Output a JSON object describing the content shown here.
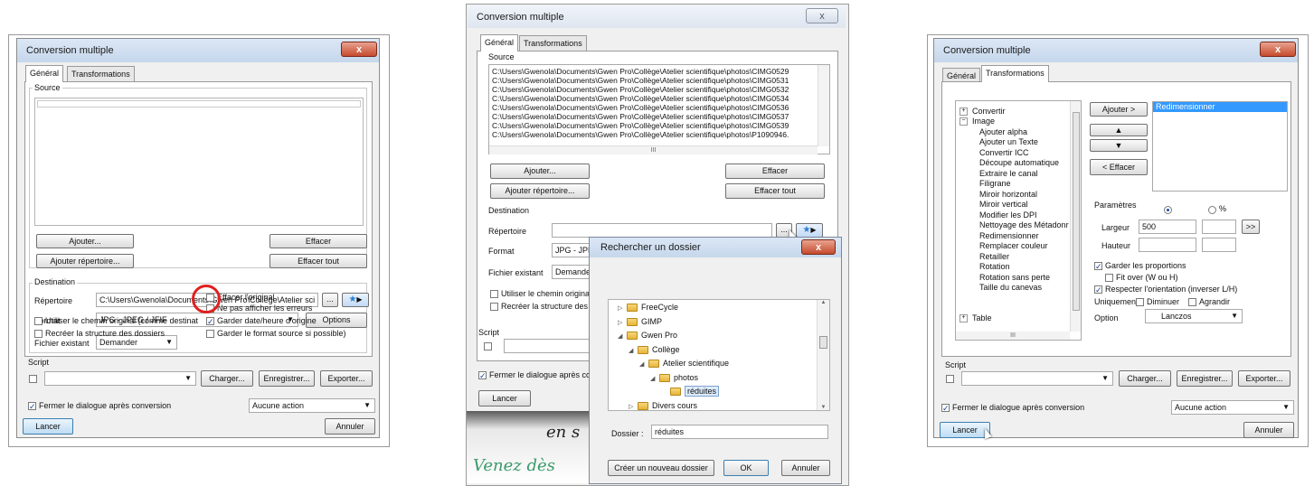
{
  "win1": {
    "title": "Conversion multiple",
    "close": "x",
    "tabs": [
      "Général",
      "Transformations"
    ],
    "source_label": "Source",
    "btn_add": "Ajouter...",
    "btn_add_dir": "Ajouter répertoire...",
    "btn_clear": "Effacer",
    "btn_clear_all": "Effacer tout",
    "dest_label": "Destination",
    "rep_label": "Répertoire",
    "rep_value": "C:\\Users\\Gwenola\\Documents\\Gwen Pro\\Collège\\Atelier sci",
    "browse": "...",
    "format_label": "Format",
    "format_value": "JPG - JPEG / JFIF",
    "options": "Options",
    "existing_label": "Fichier existant",
    "existing_value": "Demander",
    "opt_delete": "Effacer l'original",
    "opt_noerrors": "Ne pas afficher les erreurs",
    "opt_origpath": "Utiliser le chemin original (comme destinat",
    "opt_keepdate": "Garder date/heure d'origine",
    "opt_recreate": "Recréer la structure des dossiers",
    "opt_keepformat": "Garder le format source si possible)",
    "script_label": "Script",
    "load": "Charger...",
    "save": "Enregistrer...",
    "export": "Exporter...",
    "close_after": "Fermer le dialogue après conversion",
    "action": "Aucune action",
    "run": "Lancer",
    "cancel": "Annuler"
  },
  "win2": {
    "title": "Conversion multiple",
    "close": "x",
    "tabs": [
      "Général",
      "Transformations"
    ],
    "source_label": "Source",
    "paths": [
      "C:\\Users\\Gwenola\\Documents\\Gwen Pro\\Collège\\Atelier scientifique\\photos\\CIMG0529",
      "C:\\Users\\Gwenola\\Documents\\Gwen Pro\\Collège\\Atelier scientifique\\photos\\CIMG0531",
      "C:\\Users\\Gwenola\\Documents\\Gwen Pro\\Collège\\Atelier scientifique\\photos\\CIMG0532",
      "C:\\Users\\Gwenola\\Documents\\Gwen Pro\\Collège\\Atelier scientifique\\photos\\CIMG0534",
      "C:\\Users\\Gwenola\\Documents\\Gwen Pro\\Collège\\Atelier scientifique\\photos\\CIMG0536",
      "C:\\Users\\Gwenola\\Documents\\Gwen Pro\\Collège\\Atelier scientifique\\photos\\CIMG0537",
      "C:\\Users\\Gwenola\\Documents\\Gwen Pro\\Collège\\Atelier scientifique\\photos\\CIMG0539",
      "C:\\Users\\Gwenola\\Documents\\Gwen Pro\\Collège\\Atelier scientifique\\photos\\P1090946."
    ],
    "hscroll_mark": "III",
    "btn_add": "Ajouter...",
    "btn_add_dir": "Ajouter répertoire...",
    "btn_clear": "Effacer",
    "btn_clear_all": "Effacer tout",
    "dest_label": "Destination",
    "rep_label": "Répertoire",
    "browse": "...",
    "format_label": "Format",
    "format_value": "JPG - JPEG",
    "existing_label": "Fichier existant",
    "existing_value": "Demander",
    "opt_origpath": "Utiliser le chemin original (",
    "opt_recreate": "Recréer la structure des d",
    "script_label": "Script",
    "close_after": "Fermer le dialogue après com",
    "run": "Lancer",
    "bg_text1": "en s",
    "bg_text2": "Venez dès",
    "browse_dialog": {
      "title": "Rechercher un dossier",
      "close": "x",
      "tree": [
        "FreeCycle",
        "GIMP",
        "Gwen Pro",
        "Collège",
        "Atelier scientifique",
        "photos",
        "réduites",
        "Divers cours"
      ],
      "folder_label": "Dossier :",
      "folder_value": "réduites",
      "new_folder": "Créer un nouveau dossier",
      "ok": "OK",
      "cancel": "Annuler"
    }
  },
  "win3": {
    "title": "Conversion multiple",
    "close": "x",
    "tabs": [
      "Général",
      "Transformations"
    ],
    "tree": [
      "Convertir",
      "Image",
      "Ajouter alpha",
      "Ajouter un Texte",
      "Convertir ICC",
      "Découpe automatique",
      "Extraire le canal",
      "Filigrane",
      "Miroir horizontal",
      "Miroir vertical",
      "Modifier les DPI",
      "Nettoyage des Métadonr",
      "Redimensionner",
      "Remplacer couleur",
      "Retailler",
      "Rotation",
      "Rotation sans perte",
      "Taille du canevas",
      "Table"
    ],
    "hscroll_mark": "III",
    "btn_add": "Ajouter >",
    "btn_clear": "< Effacer",
    "selected": "Redimensionner",
    "params_label": "Paramètres",
    "pct": "%",
    "width_label": "Largeur",
    "width_value": "500",
    "height_label": "Hauteur",
    "more": ">>",
    "keep_ratio": "Garder les proportions",
    "fit_over": "Fit over (W ou H)",
    "respect_orient": "Respecter l'orientation (inverser L/H)",
    "only_label": "Uniquement",
    "decrease": "Diminuer",
    "enlarge": "Agrandir",
    "option_label": "Option",
    "option_value": "Lanczos",
    "script_label": "Script",
    "load": "Charger...",
    "save": "Enregistrer...",
    "export": "Exporter...",
    "close_after": "Fermer le dialogue après conversion",
    "action": "Aucune action",
    "run": "Lancer",
    "cancel": "Annuler"
  },
  "colors": {
    "accent": "#3399ff",
    "highlight_circle": "#e02020",
    "checkmark": "#1a3f99"
  }
}
